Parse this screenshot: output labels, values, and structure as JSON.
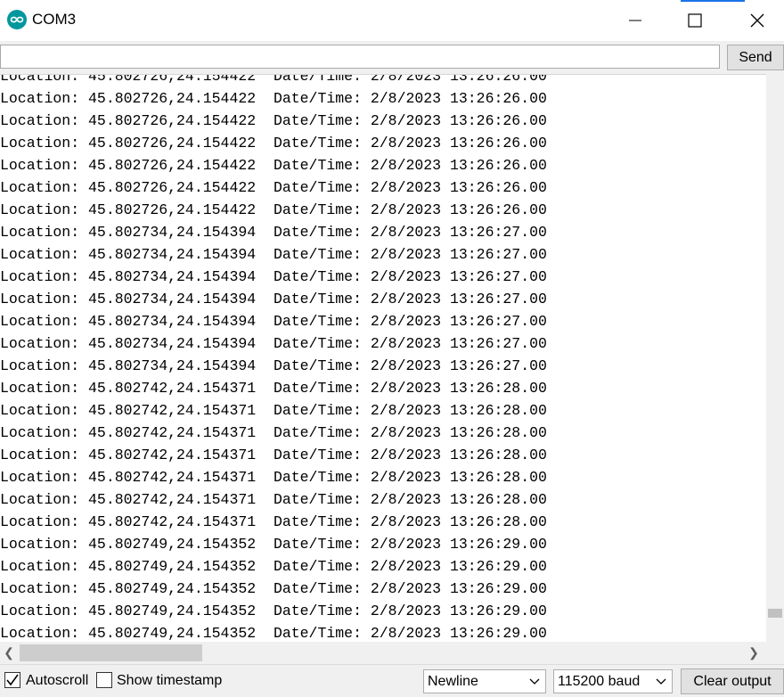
{
  "window": {
    "title": "COM3",
    "icons": {
      "app": "arduino-icon",
      "minimize": "minimize-icon",
      "maximize": "maximize-icon",
      "close": "close-icon"
    }
  },
  "send": {
    "input_value": "",
    "button_label": "Send"
  },
  "output": {
    "lines": [
      "Location: 45.802726,24.154422  Date/Time: 2/8/2023 13:26:26.00",
      "Location: 45.802726,24.154422  Date/Time: 2/8/2023 13:26:26.00",
      "Location: 45.802726,24.154422  Date/Time: 2/8/2023 13:26:26.00",
      "Location: 45.802726,24.154422  Date/Time: 2/8/2023 13:26:26.00",
      "Location: 45.802726,24.154422  Date/Time: 2/8/2023 13:26:26.00",
      "Location: 45.802726,24.154422  Date/Time: 2/8/2023 13:26:26.00",
      "Location: 45.802726,24.154422  Date/Time: 2/8/2023 13:26:26.00",
      "Location: 45.802734,24.154394  Date/Time: 2/8/2023 13:26:27.00",
      "Location: 45.802734,24.154394  Date/Time: 2/8/2023 13:26:27.00",
      "Location: 45.802734,24.154394  Date/Time: 2/8/2023 13:26:27.00",
      "Location: 45.802734,24.154394  Date/Time: 2/8/2023 13:26:27.00",
      "Location: 45.802734,24.154394  Date/Time: 2/8/2023 13:26:27.00",
      "Location: 45.802734,24.154394  Date/Time: 2/8/2023 13:26:27.00",
      "Location: 45.802734,24.154394  Date/Time: 2/8/2023 13:26:27.00",
      "Location: 45.802742,24.154371  Date/Time: 2/8/2023 13:26:28.00",
      "Location: 45.802742,24.154371  Date/Time: 2/8/2023 13:26:28.00",
      "Location: 45.802742,24.154371  Date/Time: 2/8/2023 13:26:28.00",
      "Location: 45.802742,24.154371  Date/Time: 2/8/2023 13:26:28.00",
      "Location: 45.802742,24.154371  Date/Time: 2/8/2023 13:26:28.00",
      "Location: 45.802742,24.154371  Date/Time: 2/8/2023 13:26:28.00",
      "Location: 45.802742,24.154371  Date/Time: 2/8/2023 13:26:28.00",
      "Location: 45.802749,24.154352  Date/Time: 2/8/2023 13:26:29.00",
      "Location: 45.802749,24.154352  Date/Time: 2/8/2023 13:26:29.00",
      "Location: 45.802749,24.154352  Date/Time: 2/8/2023 13:26:29.00",
      "Location: 45.802749,24.154352  Date/Time: 2/8/2023 13:26:29.00",
      "Location: 45.802749,24.154352  Date/Time: 2/8/2023 13:26:29.00"
    ]
  },
  "bottom": {
    "autoscroll": {
      "label": "Autoscroll",
      "checked": true
    },
    "timestamp": {
      "label": "Show timestamp",
      "checked": false
    },
    "line_ending": "Newline",
    "baud": "115200 baud",
    "clear_label": "Clear output"
  },
  "colors": {
    "arduino_teal": "#00979c",
    "accent_blue": "#1a73e8"
  }
}
